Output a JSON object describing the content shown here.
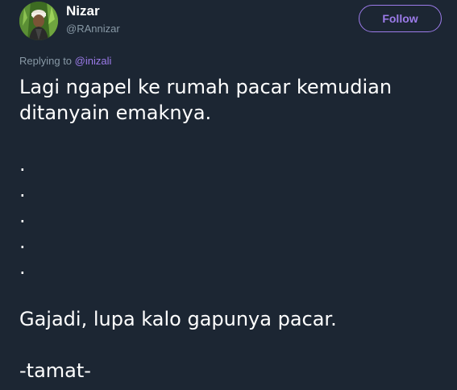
{
  "user": {
    "display_name": "Nizar",
    "handle": "@RAnnizar"
  },
  "follow_button": {
    "label": "Follow"
  },
  "reply_context": {
    "prefix": "Replying to ",
    "mention": "@inizali"
  },
  "tweet": {
    "lines": [
      "Lagi ngapel ke rumah pacar kemudian",
      "ditanyain emaknya.",
      "",
      ".",
      ".",
      ".",
      ".",
      ".",
      "",
      "Gajadi, lupa kalo gapunya pacar.",
      "",
      "-tamat-"
    ]
  },
  "colors": {
    "background": "#1c2633",
    "accent": "#9c7bea",
    "secondary_text": "#8899a6",
    "primary_text": "#ffffff"
  }
}
